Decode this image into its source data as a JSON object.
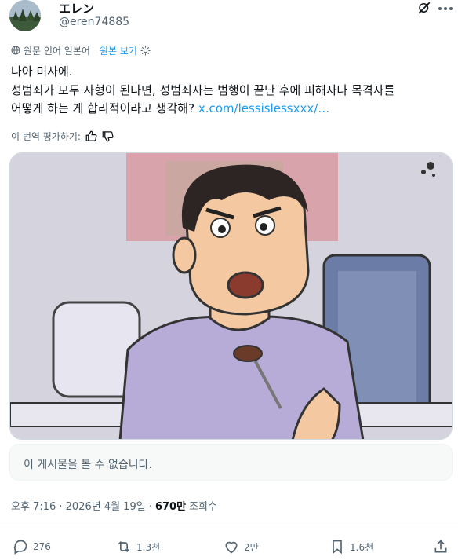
{
  "author": {
    "display_name": "エレン",
    "handle": "@eren74885",
    "verified_icon": "x-logo-icon",
    "more_icon": "more-icon"
  },
  "translation": {
    "icon": "globe-icon",
    "label": "원문 언어 일본어",
    "show_original": "원본 보기",
    "settings_icon": "gear-icon"
  },
  "tweet": {
    "line1": "나아 미사에.",
    "line2": "성범죄가 모두 사형이 된다면, 성범죄자는 범행이 끝난 후에 피해자나 목격자를",
    "line3": "어떻게 하는 게 합리적이라고 생각해?",
    "url": "x.com/lessislessxxx/…"
  },
  "rate_translation": {
    "label": "이 번역 평가하기:",
    "thumbs_up_icon": "thumbs-up-icon",
    "thumbs_down_icon": "thumbs-down-icon"
  },
  "media": {
    "kind": "cartoon-image"
  },
  "quoted_post": {
    "message": "이 게시물을 볼 수 없습니다."
  },
  "meta": {
    "time": "오후 7:16 · 2026년 4월 19일 ·",
    "views_count": "670만",
    "views_label": "조회수"
  },
  "actions": {
    "reply_count": "276",
    "retweet_count": "1.3천",
    "like_count": "2만",
    "bookmark_count": "1.6천"
  },
  "colors": {
    "link": "#1d9bf0",
    "muted": "#536471",
    "text": "#0f1419"
  }
}
